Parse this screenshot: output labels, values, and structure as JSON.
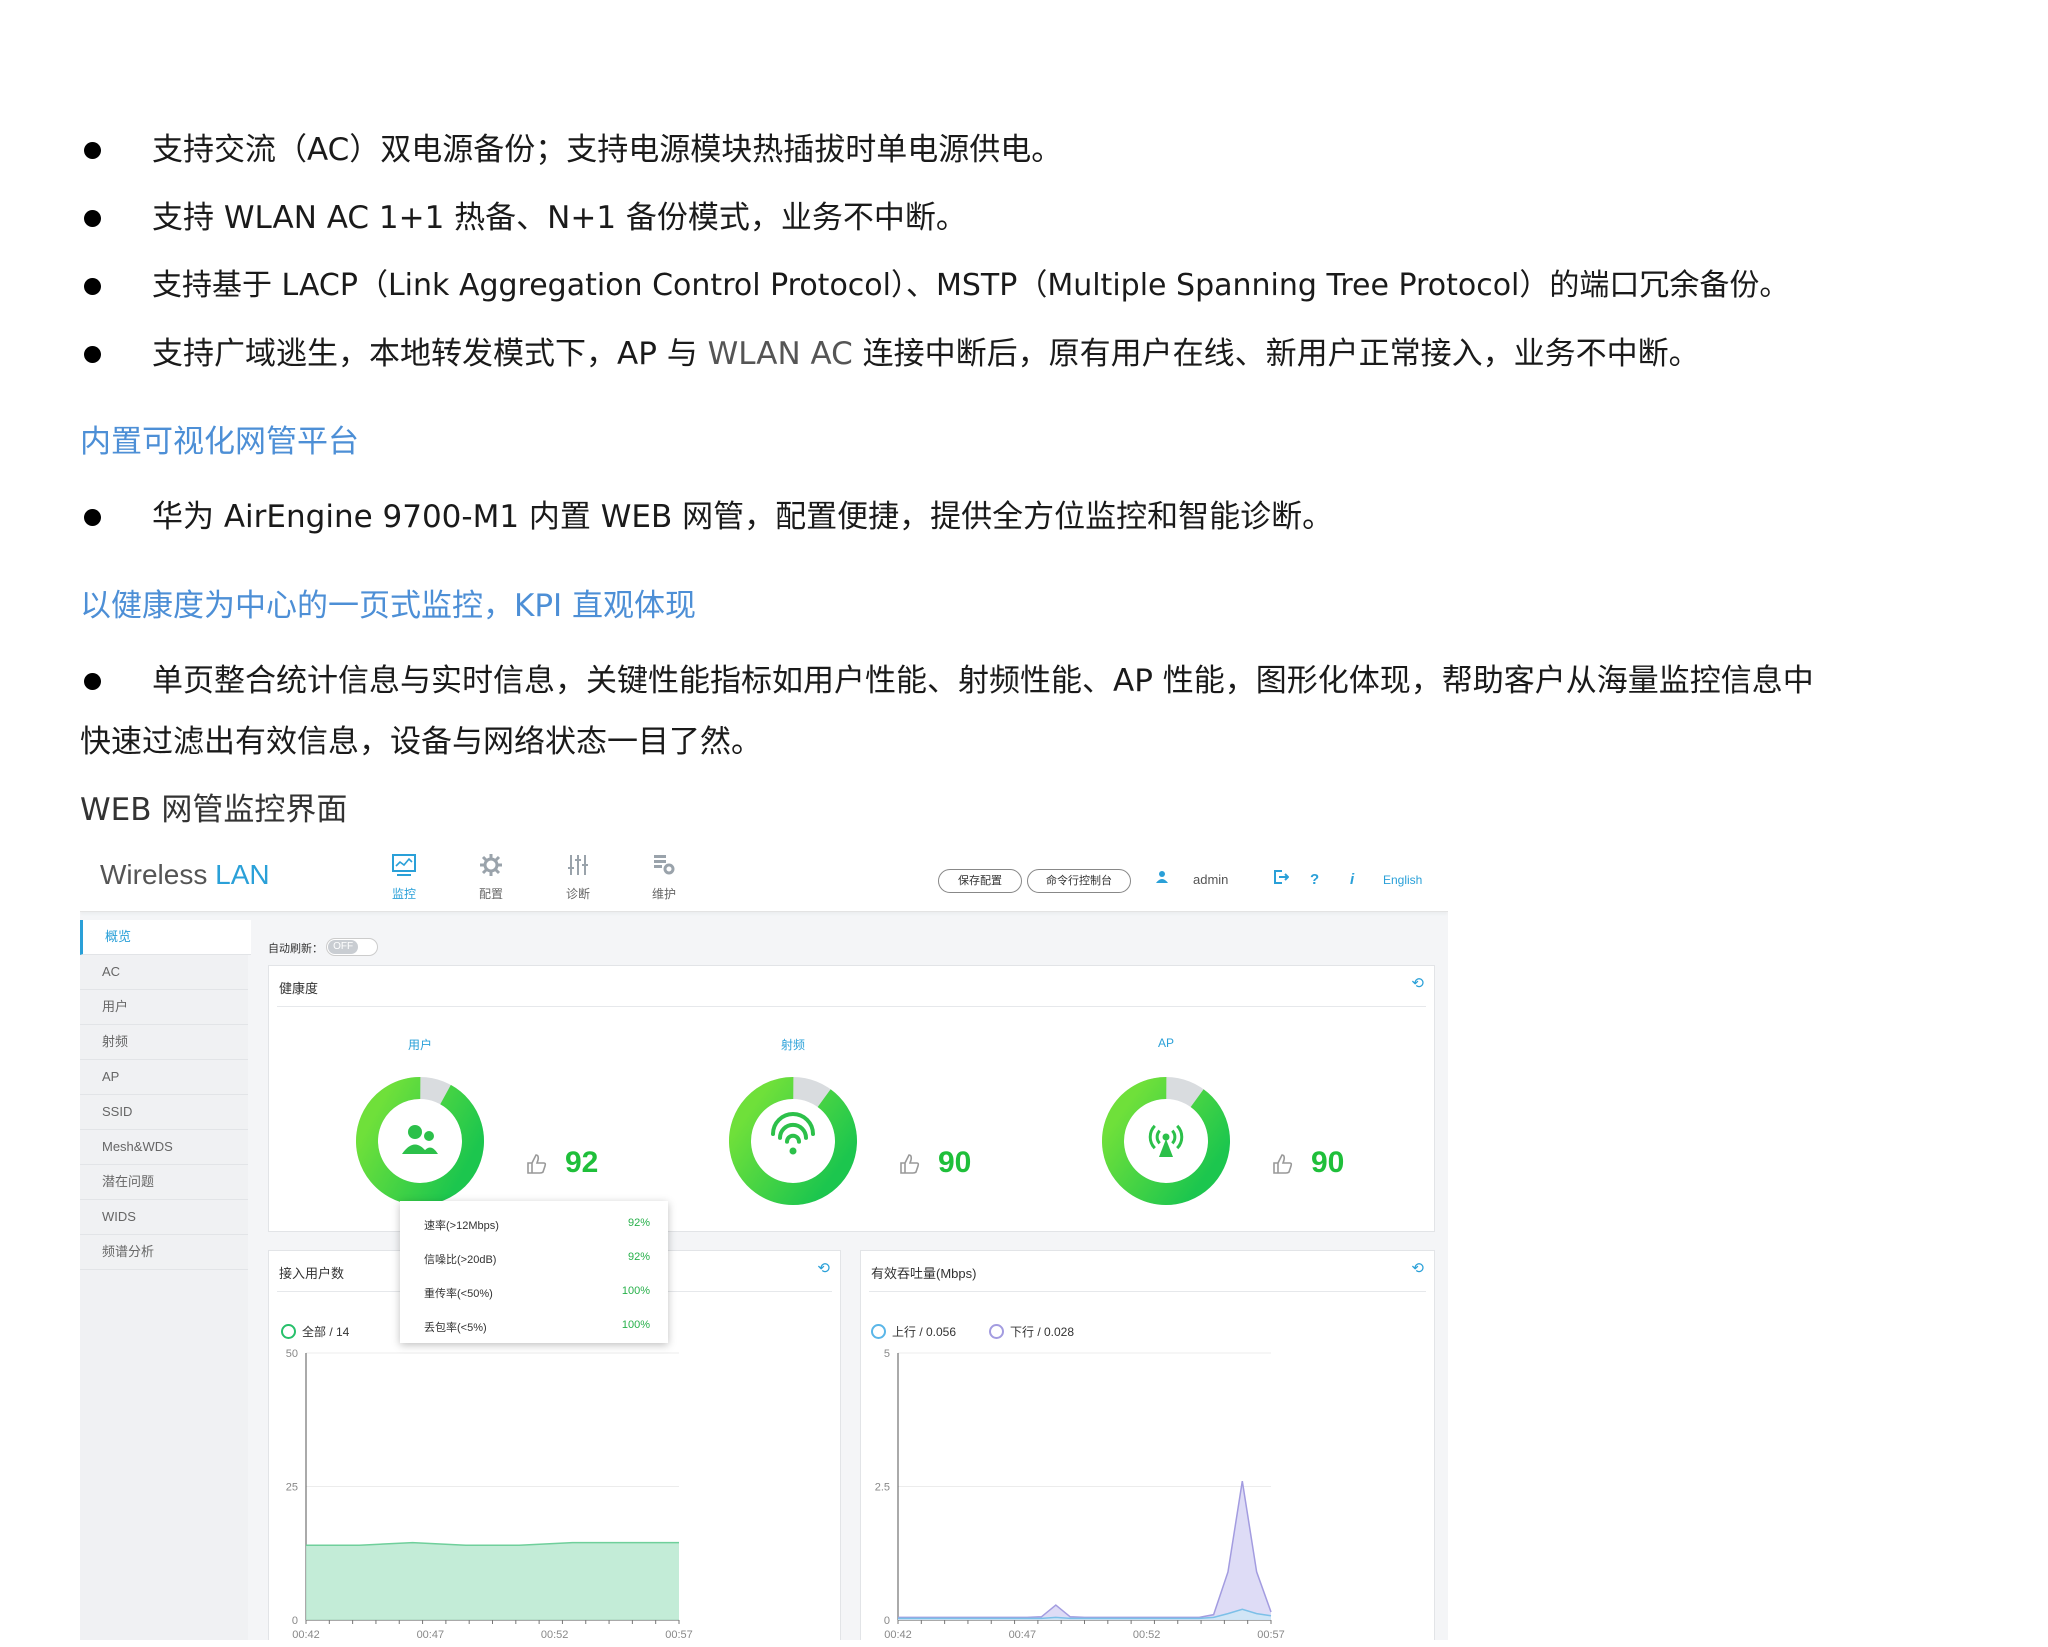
{
  "bullets": [
    {
      "text": "支持交流（AC）双电源备份；支持电源模块热插拔时单电源供电。"
    },
    {
      "text": "支持 WLAN AC 1+1 热备、N+1 备份模式，业务不中断。"
    },
    {
      "text": "支持基于 LACP（Link Aggregation Control Protocol）、MSTP（Multiple Spanning Tree Protocol）的端口冗余备份。"
    },
    {
      "pre": "支持广域逃生，本地转发模式下，AP 与 ",
      "gray": "WLAN AC",
      "post": " 连接中断后，原有用户在线、新用户正常接入，业务不中断。"
    }
  ],
  "heading1": "内置可视化网管平台",
  "bullet5": "华为 AirEngine 9700-M1 内置 WEB 网管，配置便捷，提供全方位监控和智能诊断。",
  "heading2": "以健康度为中心的一页式监控，KPI 直观体现",
  "bullet6_line1": "单页整合统计信息与实时信息，关键性能指标如用户性能、射频性能、AP 性能，图形化体现，帮助客户从海量监控信息中",
  "bullet6_line2": "快速过滤出有效信息，设备与网络状态一目了然。",
  "caption": "WEB 网管监控界面",
  "ui": {
    "brand_wireless": "Wireless",
    "brand_lan": "LAN",
    "nav": [
      {
        "label": "监控",
        "icon": "monitor-icon"
      },
      {
        "label": "配置",
        "icon": "gear-icon"
      },
      {
        "label": "诊断",
        "icon": "sliders-icon"
      },
      {
        "label": "维护",
        "icon": "maintenance-icon"
      }
    ],
    "save_config": "保存配置",
    "cli_console": "命令行控制台",
    "user": "admin",
    "logout_icon": "logout-icon",
    "help": "?",
    "info": "i",
    "language": "English",
    "sidebar": [
      "概览",
      "AC",
      "用户",
      "射频",
      "AP",
      "SSID",
      "Mesh&WDS",
      "潜在问题",
      "WIDS",
      "频谱分析"
    ],
    "auto_refresh_label": "自动刷新：",
    "auto_refresh_state": "OFF",
    "health_title": "健康度",
    "gauges": [
      {
        "title": "用户",
        "score": "92",
        "level": 0.92,
        "icon": "users-icon"
      },
      {
        "title": "射频",
        "score": "90",
        "level": 0.9,
        "icon": "wifi-icon"
      },
      {
        "title": "AP",
        "score": "90",
        "level": 0.9,
        "icon": "antenna-icon"
      }
    ],
    "tooltip": [
      {
        "label": "速率(>12Mbps)",
        "value": "92%"
      },
      {
        "label": "信噪比(>20dB)",
        "value": "92%"
      },
      {
        "label": "重传率(<50%)",
        "value": "100%"
      },
      {
        "label": "丢包率(<5%)",
        "value": "100%"
      }
    ],
    "users_panel_title": "接入用户数",
    "users_legend": "全部 / 14",
    "throughput_title": "有效吞吐量(Mbps)",
    "up_legend": "上行 / 0.056",
    "down_legend": "下行 / 0.028",
    "colors": {
      "accent": "#2aa0d8",
      "green": "#1fbf3a",
      "area_green": "#b8e9d0",
      "area_purple": "#d8d6f4"
    }
  },
  "chart_data": [
    {
      "type": "area",
      "title": "接入用户数",
      "x": [
        "00:42",
        "00:47",
        "00:52",
        "00:57"
      ],
      "ylim": [
        0,
        50
      ],
      "yticks": [
        0,
        25,
        50
      ],
      "series": [
        {
          "name": "全部",
          "values": [
            14,
            14,
            14.5,
            14,
            14,
            14.5,
            14.5,
            14.5
          ]
        }
      ]
    },
    {
      "type": "area",
      "title": "有效吞吐量(Mbps)",
      "x": [
        "00:42",
        "00:47",
        "00:52",
        "00:57"
      ],
      "ylim": [
        0,
        5
      ],
      "yticks": [
        0,
        2.5,
        5
      ],
      "series": [
        {
          "name": "上行",
          "values": [
            0.05,
            0.05,
            0.05,
            0.05,
            0.05,
            0.05,
            0.05,
            0.05,
            0.05,
            0.05,
            0.06,
            0.28,
            0.06,
            0.05,
            0.05,
            0.05,
            0.05,
            0.05,
            0.05,
            0.05,
            0.05,
            0.05,
            0.1,
            0.9,
            2.6,
            0.9,
            0.15
          ]
        },
        {
          "name": "下行",
          "values": [
            0.03,
            0.03,
            0.03,
            0.03,
            0.03,
            0.03,
            0.03,
            0.03,
            0.03,
            0.03,
            0.03,
            0.05,
            0.03,
            0.03,
            0.03,
            0.03,
            0.03,
            0.03,
            0.03,
            0.03,
            0.03,
            0.03,
            0.05,
            0.12,
            0.2,
            0.12,
            0.08
          ]
        }
      ]
    }
  ]
}
